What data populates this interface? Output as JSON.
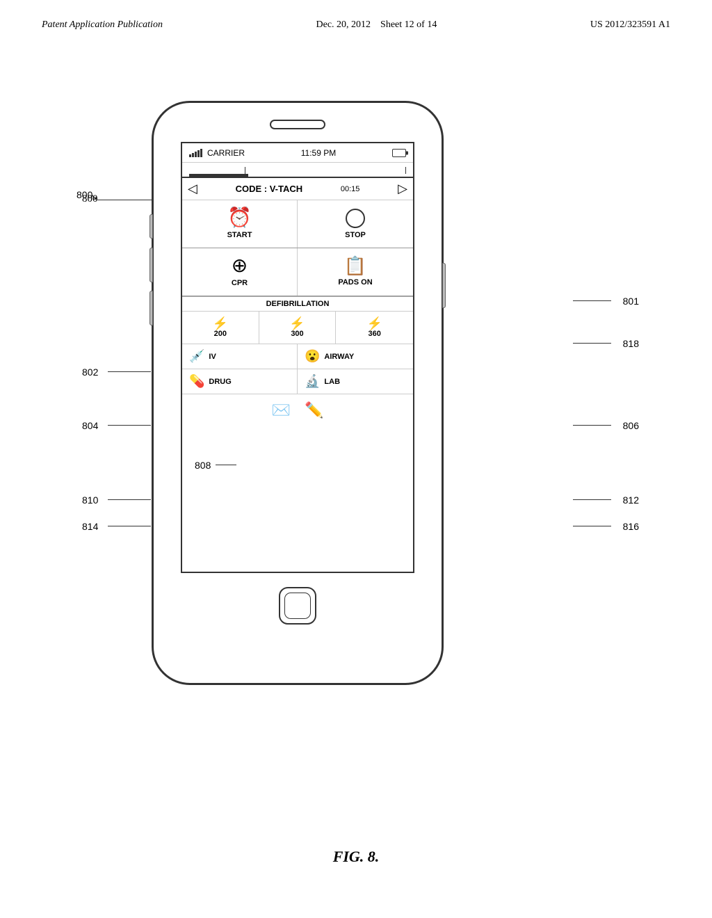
{
  "header": {
    "left": "Patent Application Publication",
    "center_date": "Dec. 20, 2012",
    "center_sheet": "Sheet 12 of 14",
    "right": "US 2012/323591 A1"
  },
  "figure": {
    "label": "FIG. 8.",
    "number": "800",
    "arrow_label": "800"
  },
  "phone": {
    "status_bar": {
      "carrier": "CARRIER",
      "time": "11:59 PM"
    },
    "nav": {
      "title": "CODE : V-TACH",
      "timer": "00:15",
      "left_arrow": "◁",
      "right_arrow": "▷"
    },
    "buttons": [
      {
        "icon": "⏰",
        "label": "START"
      },
      {
        "icon": "○",
        "label": "STOP"
      },
      {
        "icon": "⊕",
        "label": "CPR"
      },
      {
        "icon": "📋",
        "label": "PADS ON"
      }
    ],
    "defibrillation": {
      "label": "DEFIBRILLATION",
      "options": [
        {
          "icon": "↯",
          "value": "200"
        },
        {
          "icon": "↯",
          "value": "300"
        },
        {
          "icon": "↯",
          "value": "360"
        }
      ]
    },
    "action_buttons": [
      {
        "icon": "🩺",
        "label": "IV"
      },
      {
        "icon": "😮",
        "label": "AIRWAY"
      },
      {
        "icon": "💊",
        "label": "DRUG"
      },
      {
        "icon": "🔬",
        "label": "LAB"
      }
    ],
    "footer_icons": [
      "✉",
      "✏"
    ]
  },
  "annotations": [
    {
      "id": "800",
      "label": "800"
    },
    {
      "id": "801",
      "label": "801"
    },
    {
      "id": "802",
      "label": "802"
    },
    {
      "id": "804",
      "label": "804"
    },
    {
      "id": "806",
      "label": "806"
    },
    {
      "id": "808",
      "label": "808"
    },
    {
      "id": "810",
      "label": "810"
    },
    {
      "id": "812",
      "label": "812"
    },
    {
      "id": "814",
      "label": "814"
    },
    {
      "id": "816",
      "label": "816"
    },
    {
      "id": "818",
      "label": "818"
    }
  ]
}
